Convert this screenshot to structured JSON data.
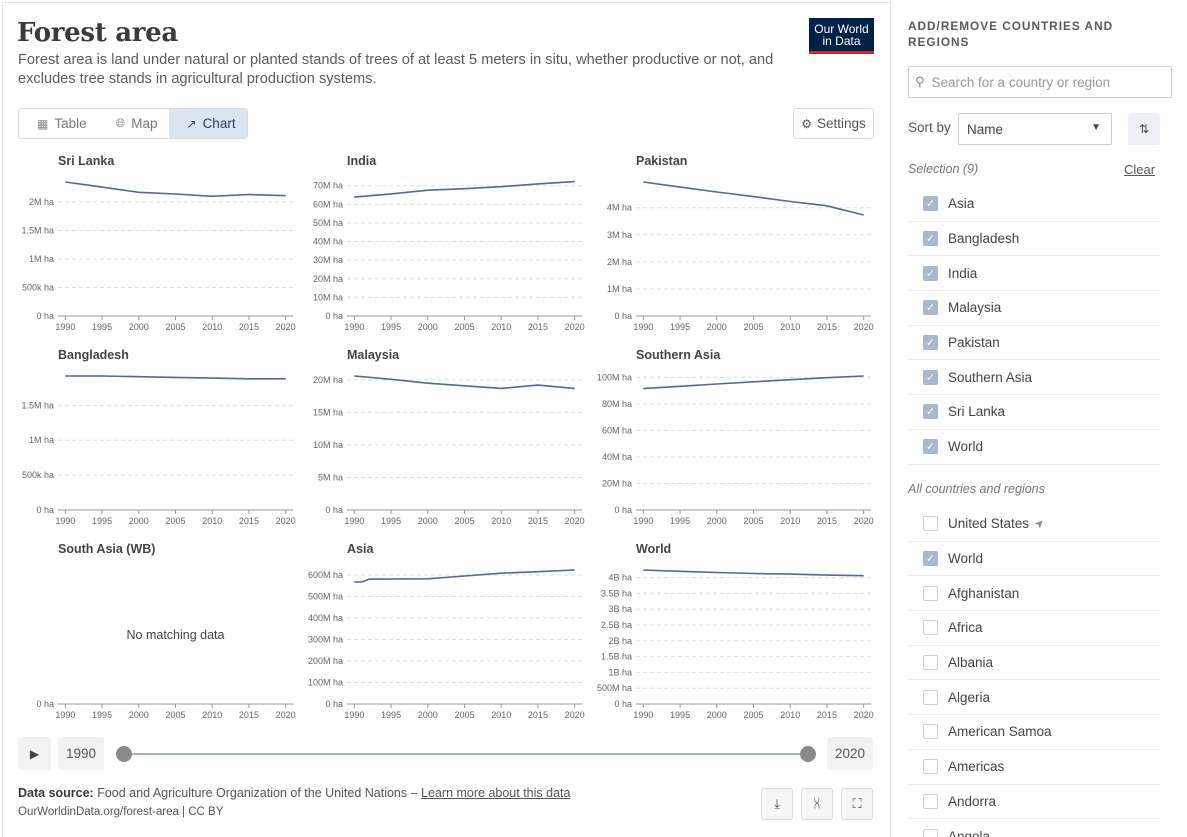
{
  "header": {
    "title": "Forest area",
    "subtitle": "Forest area is land under natural or planted stands of trees of at least 5 meters in situ, whether productive or not, and excludes tree stands in agricultural production systems.",
    "logo_line1": "Our World",
    "logo_line2": "in Data"
  },
  "tabs": [
    {
      "label": "Table",
      "icon": "table-icon"
    },
    {
      "label": "Map",
      "icon": "globe-icon"
    },
    {
      "label": "Chart",
      "icon": "line-chart-icon",
      "active": true
    }
  ],
  "settings_label": "Settings",
  "colors": {
    "line": "#4c6a9c",
    "grid": "#dddddd",
    "axis": "#666666"
  },
  "chart_data": [
    {
      "type": "line",
      "title": "Sri Lanka",
      "x": [
        1990,
        1995,
        2000,
        2005,
        2010,
        2015,
        2020
      ],
      "y": [
        2350000,
        2260000,
        2170000,
        2140000,
        2100000,
        2130000,
        2110000
      ],
      "ylim": [
        0,
        2350000
      ],
      "yticks": [
        "0 ha",
        "500k ha",
        "1M ha",
        "1.5M ha",
        "2M ha"
      ],
      "ytick_values": [
        0,
        500000,
        1000000,
        1500000,
        2000000
      ]
    },
    {
      "type": "line",
      "title": "India",
      "x": [
        1990,
        1995,
        2000,
        2005,
        2010,
        2015,
        2020
      ],
      "y": [
        63900000,
        65600000,
        67600000,
        68400000,
        69500000,
        71000000,
        72200000
      ],
      "ylim": [
        0,
        72000000
      ],
      "yticks": [
        "0 ha",
        "10M ha",
        "20M ha",
        "30M ha",
        "40M ha",
        "50M ha",
        "60M ha",
        "70M ha"
      ],
      "ytick_values": [
        0,
        10000000,
        20000000,
        30000000,
        40000000,
        50000000,
        60000000,
        70000000
      ]
    },
    {
      "type": "line",
      "title": "Pakistan",
      "x": [
        1990,
        1995,
        2000,
        2005,
        2010,
        2015,
        2020
      ],
      "y": [
        4950000,
        4760000,
        4580000,
        4410000,
        4230000,
        4070000,
        3730000
      ],
      "ylim": [
        0,
        4950000
      ],
      "yticks": [
        "0 ha",
        "1M ha",
        "2M ha",
        "3M ha",
        "4M ha"
      ],
      "ytick_values": [
        0,
        1000000,
        2000000,
        3000000,
        4000000
      ]
    },
    {
      "type": "line",
      "title": "Bangladesh",
      "x": [
        1990,
        1995,
        2000,
        2005,
        2010,
        2015,
        2020
      ],
      "y": [
        1920000,
        1920000,
        1910000,
        1900000,
        1890000,
        1880000,
        1880000
      ],
      "ylim": [
        0,
        1920000
      ],
      "yticks": [
        "0 ha",
        "500k ha",
        "1M ha",
        "1.5M ha"
      ],
      "ytick_values": [
        0,
        500000,
        1000000,
        1500000
      ]
    },
    {
      "type": "line",
      "title": "Malaysia",
      "x": [
        1990,
        1995,
        2000,
        2005,
        2010,
        2015,
        2020
      ],
      "y": [
        20600000,
        20100000,
        19500000,
        19100000,
        18700000,
        19200000,
        18700000
      ],
      "ylim": [
        0,
        20600000
      ],
      "yticks": [
        "0 ha",
        "5M ha",
        "10M ha",
        "15M ha",
        "20M ha"
      ],
      "ytick_values": [
        0,
        5000000,
        10000000,
        15000000,
        20000000
      ]
    },
    {
      "type": "line",
      "title": "Southern Asia",
      "x": [
        1990,
        1995,
        2000,
        2005,
        2010,
        2015,
        2020
      ],
      "y": [
        91500000,
        93200000,
        95000000,
        96600000,
        98200000,
        99700000,
        101000000
      ],
      "ylim": [
        0,
        101000000
      ],
      "yticks": [
        "0 ha",
        "20M ha",
        "40M ha",
        "60M ha",
        "80M ha",
        "100M ha"
      ],
      "ytick_values": [
        0,
        20000000,
        40000000,
        60000000,
        80000000,
        100000000
      ]
    },
    {
      "type": "line",
      "title": "South Asia (WB)",
      "x": [],
      "y": [],
      "empty_text": "No matching data",
      "yticks": [
        "0 ha"
      ],
      "ytick_values": [
        0
      ],
      "ylim": [
        0,
        1
      ]
    },
    {
      "type": "line",
      "title": "Asia",
      "x": [
        1990,
        1991,
        1992,
        1995,
        2000,
        2005,
        2010,
        2015,
        2020
      ],
      "y": [
        567000000,
        567000000,
        580000000,
        581000000,
        582000000,
        595000000,
        608000000,
        615000000,
        623000000
      ],
      "ylim": [
        0,
        623000000
      ],
      "yticks": [
        "0 ha",
        "100M ha",
        "200M ha",
        "300M ha",
        "400M ha",
        "500M ha",
        "600M ha"
      ],
      "ytick_values": [
        0,
        100000000,
        200000000,
        300000000,
        400000000,
        500000000,
        600000000
      ]
    },
    {
      "type": "line",
      "title": "World",
      "x": [
        1990,
        1995,
        2000,
        2005,
        2010,
        2015,
        2020
      ],
      "y": [
        4240000000,
        4200000000,
        4160000000,
        4130000000,
        4110000000,
        4080000000,
        4060000000
      ],
      "ylim": [
        0,
        4240000000
      ],
      "yticks": [
        "0 ha",
        "500M ha",
        "1B ha",
        "1.5B ha",
        "2B ha",
        "2.5B ha",
        "3B ha",
        "3.5B ha",
        "4B ha"
      ],
      "ytick_values": [
        0,
        500000000,
        1000000000,
        1500000000,
        2000000000,
        2500000000,
        3000000000,
        3500000000,
        4000000000
      ]
    }
  ],
  "xticks": [
    "1990",
    "1995",
    "2000",
    "2005",
    "2010",
    "2015",
    "2020"
  ],
  "timeline": {
    "start": "1990",
    "end": "2020"
  },
  "footer": {
    "source_label": "Data source:",
    "source_text": "Food and Agriculture Organization of the United Nations",
    "separator": "–",
    "learn_more": "Learn more about this data",
    "url": "OurWorldinData.org/forest-area | CC BY"
  },
  "sidebar": {
    "heading": "ADD/REMOVE COUNTRIES AND REGIONS",
    "search_placeholder": "Search for a country or region",
    "sort_label": "Sort by",
    "sort_value": "Name",
    "selection_label": "Selection (9)",
    "clear_label": "Clear",
    "selected": [
      "Asia",
      "Bangladesh",
      "India",
      "Malaysia",
      "Pakistan",
      "Southern Asia",
      "Sri Lanka",
      "World"
    ],
    "all_label": "All countries and regions",
    "all": [
      {
        "name": "United States",
        "checked": false,
        "location": true
      },
      {
        "name": "World",
        "checked": true
      },
      {
        "name": "Afghanistan",
        "checked": false
      },
      {
        "name": "Africa",
        "checked": false
      },
      {
        "name": "Albania",
        "checked": false
      },
      {
        "name": "Algeria",
        "checked": false
      },
      {
        "name": "American Samoa",
        "checked": false
      },
      {
        "name": "Americas",
        "checked": false
      },
      {
        "name": "Andorra",
        "checked": false
      },
      {
        "name": "Angola",
        "checked": false
      }
    ]
  }
}
